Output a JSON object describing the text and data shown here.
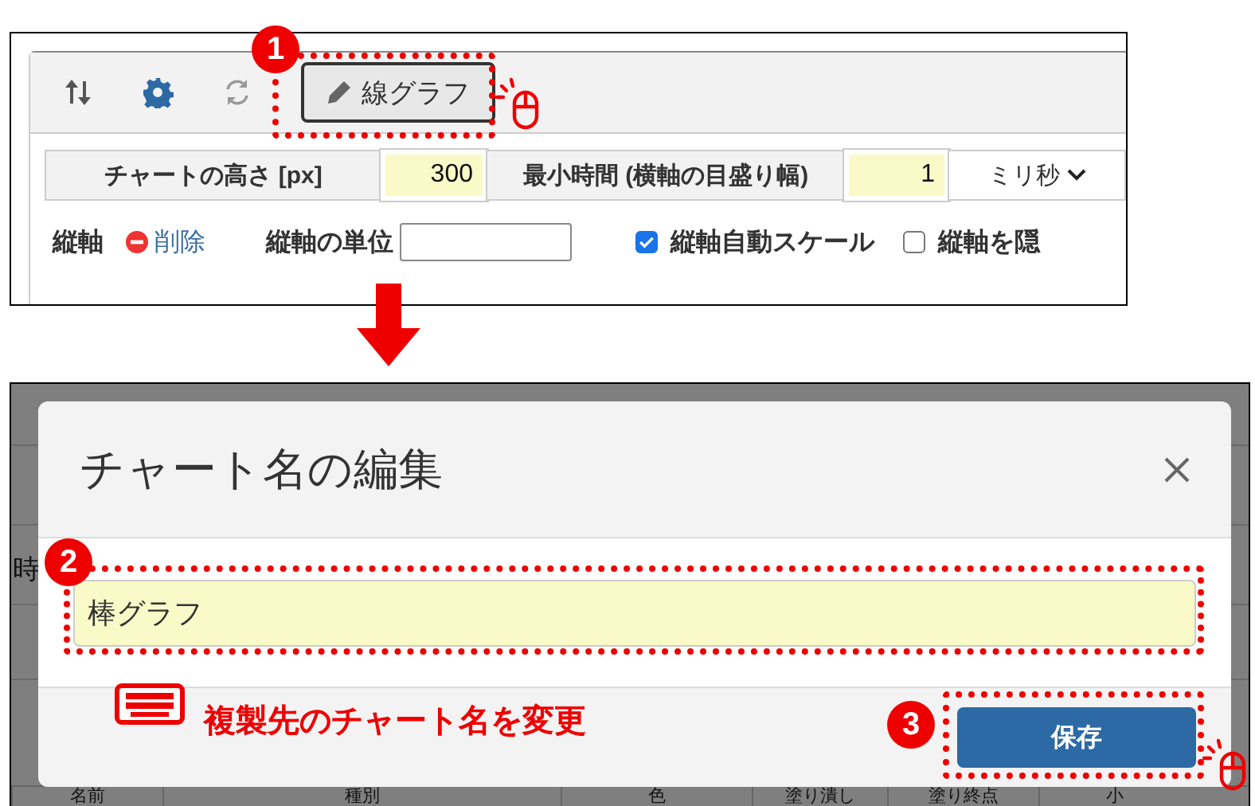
{
  "toolbar": {
    "chart_type_button": {
      "label": "線グラフ"
    }
  },
  "settings_row": {
    "height_label": "チャートの高さ [px]",
    "height_value": "300",
    "min_time_label": "最小時間 (横軸の目盛り幅)",
    "min_time_value": "1",
    "unit_select": "ミリ秒"
  },
  "axis_row": {
    "label": "縦軸",
    "delete_link": "削除",
    "unit_label": "縦軸の単位",
    "options": [
      {
        "label": "縦軸自動スケール",
        "checked": true
      },
      {
        "label": "縦軸を隠",
        "checked": false
      }
    ]
  },
  "background_table": {
    "row_label": "時",
    "columns": [
      "名前",
      "種別",
      "色",
      "塗り潰し",
      "塗り終点",
      "小"
    ]
  },
  "dialog": {
    "title": "チャート名の編集",
    "name_value": "棒グラフ",
    "save_button": "保存"
  },
  "annotations": {
    "steps": [
      "1",
      "2",
      "3"
    ],
    "note": "複製先のチャート名を変更"
  }
}
